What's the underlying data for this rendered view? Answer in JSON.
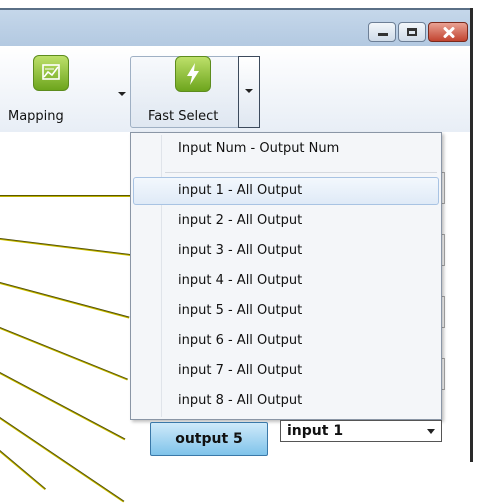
{
  "window": {
    "controls": {
      "minimize_icon": "minimize-icon",
      "maximize_icon": "maximize-icon",
      "close_icon": "close-icon"
    }
  },
  "ribbon": {
    "mapping_label": "Mapping",
    "fast_select_label": "Fast Select"
  },
  "menu": {
    "header": "Input Num - Output Num",
    "items": [
      "input 1 - All Output",
      "input 2 - All Output",
      "input 3 - All Output",
      "input 4 - All Output",
      "input 5 - All Output",
      "input 6 - All Output",
      "input 7 - All Output",
      "input 8 - All Output"
    ],
    "highlighted_index": 0
  },
  "bottom": {
    "output_button": "output 5",
    "input_select_value": "input 1"
  },
  "colors": {
    "accent_green": "#6da51d",
    "output_blue": "#7fc3ea",
    "highlight_border": "#a8c3e3",
    "close_red": "#c24430"
  }
}
